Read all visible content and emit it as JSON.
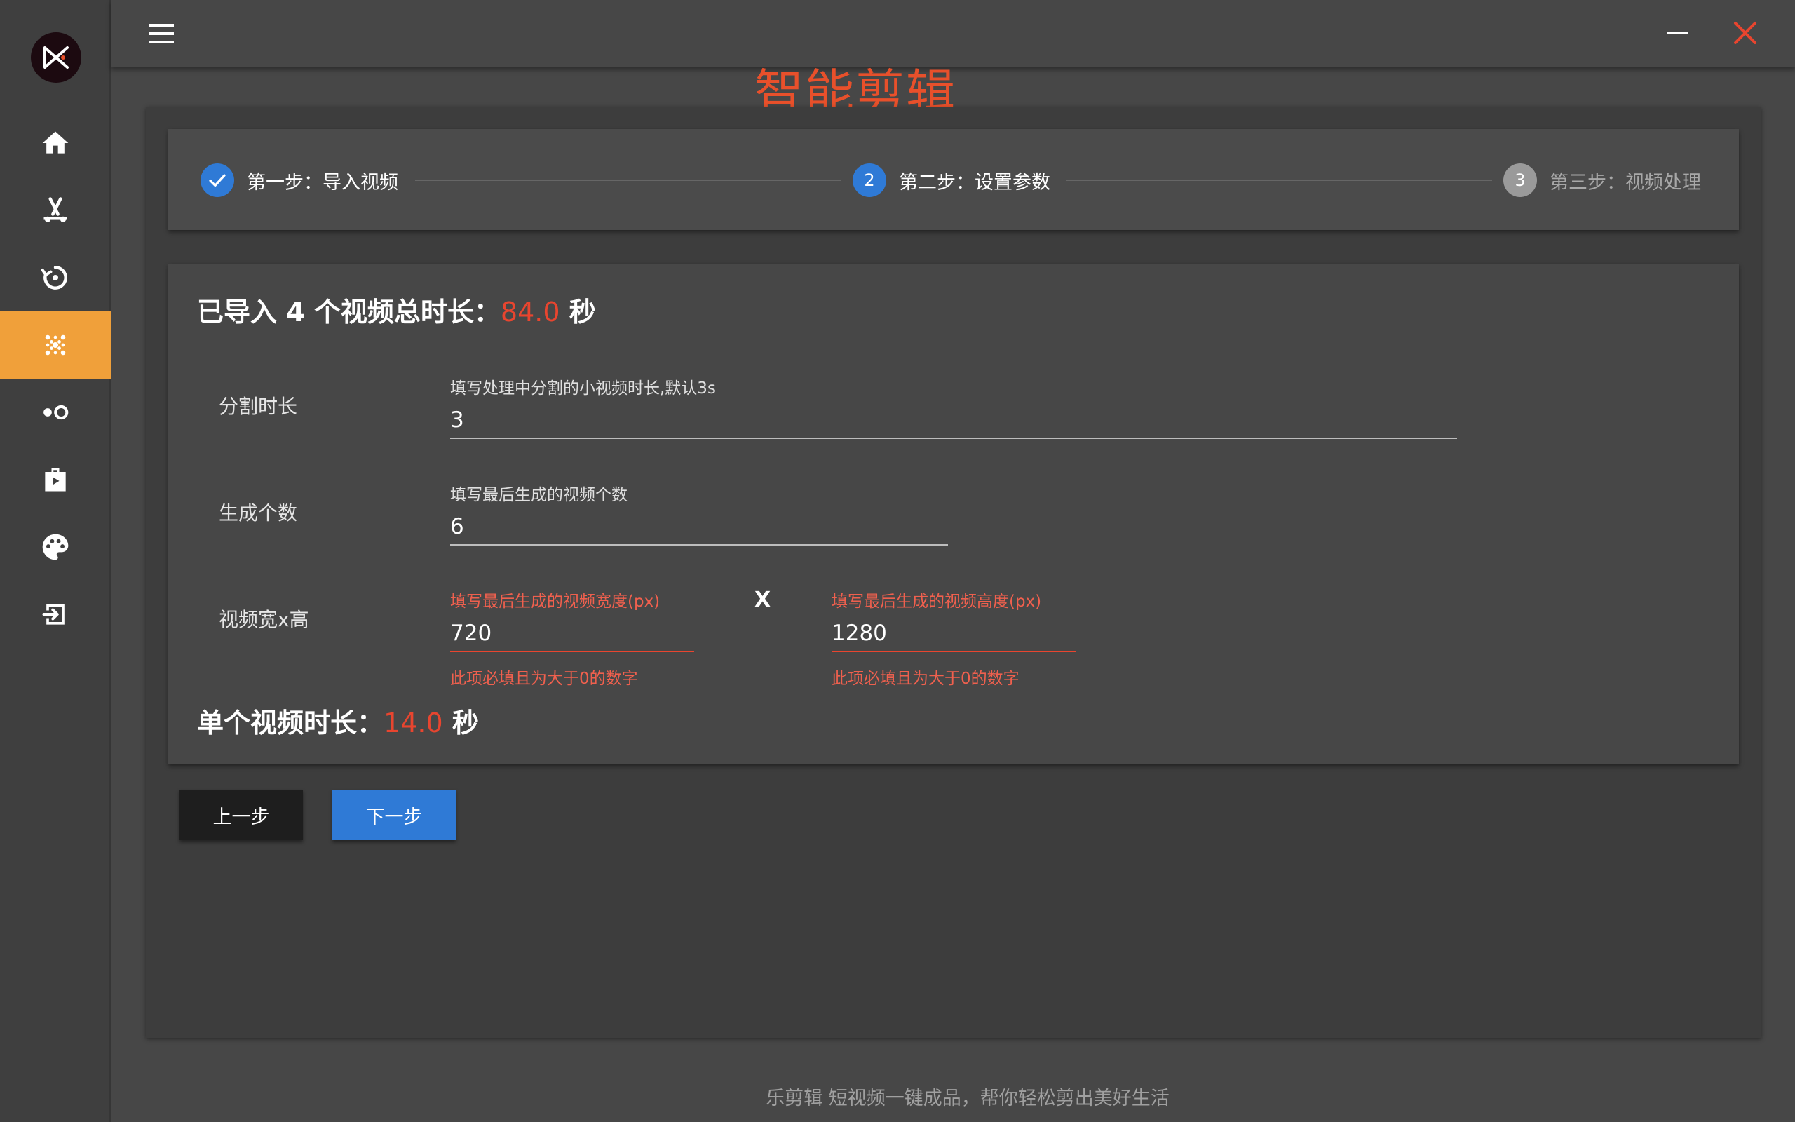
{
  "app": {
    "page_title": "智能剪辑",
    "footer": "乐剪辑 短视频一键成品，帮你轻松剪出美好生活"
  },
  "sidebar": {
    "items": [
      {
        "icon": "home-icon",
        "active": false
      },
      {
        "icon": "scissors-icon",
        "active": false
      },
      {
        "icon": "history-icon",
        "active": false
      },
      {
        "icon": "dots-grid-icon",
        "active": true
      },
      {
        "icon": "toggle-dots-icon",
        "active": false
      },
      {
        "icon": "briefcase-icon",
        "active": false
      },
      {
        "icon": "palette-icon",
        "active": false
      },
      {
        "icon": "logout-icon",
        "active": false
      }
    ],
    "active_color": "#f0a03a"
  },
  "stepper": {
    "steps": [
      {
        "number": "1",
        "label": "第一步：导入视频",
        "state": "done"
      },
      {
        "number": "2",
        "label": "第二步：设置参数",
        "state": "active"
      },
      {
        "number": "3",
        "label": "第三步：视频处理",
        "state": "pending"
      }
    ]
  },
  "summary": {
    "prefix": "已导入 4 个视频总时长：",
    "total_duration": "84.0",
    "unit": "秒"
  },
  "form": {
    "split": {
      "label": "分割时长",
      "hint": "填写处理中分割的小视频时长,默认3s",
      "value": "3"
    },
    "count": {
      "label": "生成个数",
      "hint": "填写最后生成的视频个数",
      "value": "6"
    },
    "size": {
      "label": "视频宽x高",
      "separator": "X",
      "width_hint": "填写最后生成的视频宽度(px)",
      "width_value": "720",
      "width_error": "此项必填且为大于0的数字",
      "height_hint": "填写最后生成的视频高度(px)",
      "height_value": "1280",
      "height_error": "此项必填且为大于0的数字"
    }
  },
  "single": {
    "prefix": "单个视频时长：",
    "duration": "14.0",
    "unit": "秒"
  },
  "buttons": {
    "prev": "上一步",
    "next": "下一步"
  },
  "colors": {
    "accent_red": "#e8452f",
    "primary_blue": "#2f7ad6",
    "title_orange": "#e8502b"
  }
}
